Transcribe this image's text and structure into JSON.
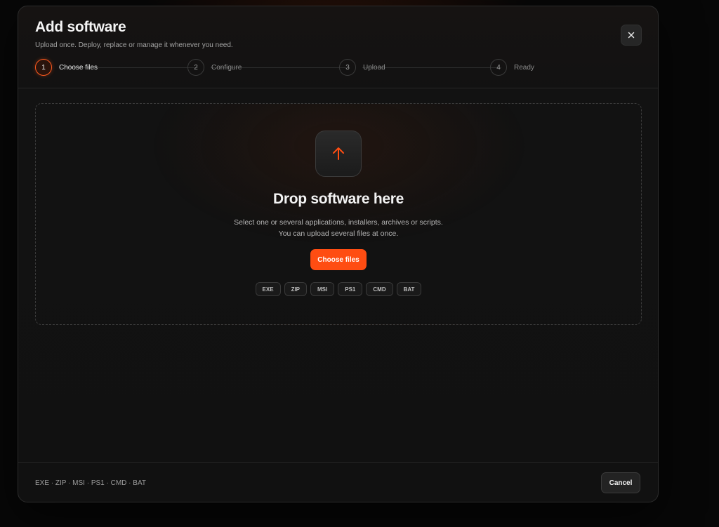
{
  "modal": {
    "title": "Add software",
    "subtitle": "Upload once. Deploy, replace or manage it whenever you need.",
    "close_icon": "close-icon"
  },
  "steps": [
    {
      "number": "1",
      "label": "Choose files",
      "active": true
    },
    {
      "number": "2",
      "label": "Configure",
      "active": false
    },
    {
      "number": "3",
      "label": "Upload",
      "active": false
    },
    {
      "number": "4",
      "label": "Ready",
      "active": false
    }
  ],
  "dropzone": {
    "icon": "arrow-up-icon",
    "title": "Drop software here",
    "description_line1": "Select one or several applications, installers, archives or scripts.",
    "description_line2": "You can upload several files at once.",
    "button_label": "Choose files",
    "formats": [
      "EXE",
      "ZIP",
      "MSI",
      "PS1",
      "CMD",
      "BAT"
    ]
  },
  "footer": {
    "formats_text": "EXE · ZIP · MSI · PS1 · CMD · BAT",
    "cancel_label": "Cancel"
  },
  "colors": {
    "accent": "#ff4d12",
    "background": "#111111"
  }
}
